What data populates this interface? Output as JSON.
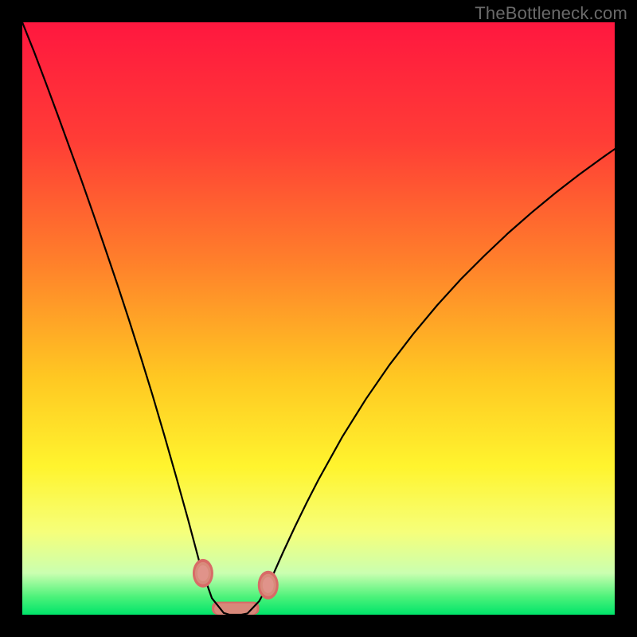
{
  "watermark": "TheBottleneck.com",
  "chart_data": {
    "type": "line",
    "title": "",
    "xlabel": "",
    "ylabel": "",
    "xlim": [
      0,
      100
    ],
    "ylim": [
      0,
      100
    ],
    "gradient_stops": [
      {
        "offset": 0,
        "color": "#ff173f"
      },
      {
        "offset": 20,
        "color": "#ff3d36"
      },
      {
        "offset": 40,
        "color": "#ff7e2b"
      },
      {
        "offset": 60,
        "color": "#ffc822"
      },
      {
        "offset": 75,
        "color": "#fff42e"
      },
      {
        "offset": 86,
        "color": "#f6ff7a"
      },
      {
        "offset": 93,
        "color": "#caffb0"
      },
      {
        "offset": 97,
        "color": "#4cf27a"
      },
      {
        "offset": 100,
        "color": "#00e46a"
      }
    ],
    "series": [
      {
        "name": "bottleneck-curve",
        "x": [
          0.0,
          2,
          4,
          6,
          8,
          10,
          12,
          14,
          16,
          18,
          20,
          22,
          24,
          26,
          28,
          30,
          32,
          34,
          35,
          36,
          37,
          38,
          40,
          42,
          44,
          46,
          48,
          50,
          54,
          58,
          62,
          66,
          70,
          74,
          78,
          82,
          86,
          90,
          94,
          98,
          100
        ],
        "values": [
          100,
          95,
          89.7,
          84.3,
          78.8,
          73.3,
          67.6,
          61.8,
          55.9,
          49.8,
          43.5,
          37,
          30.2,
          23.2,
          16,
          8.5,
          2.8,
          0.3,
          0,
          0,
          0,
          0.2,
          2.3,
          6,
          10.5,
          14.8,
          18.9,
          22.8,
          30,
          36.4,
          42.2,
          47.4,
          52.2,
          56.6,
          60.6,
          64.4,
          67.9,
          71.2,
          74.3,
          77.2,
          78.6
        ]
      }
    ],
    "markers": [
      {
        "name": "left-fat-dot",
        "x": 30.5,
        "y": 7.0,
        "colors": [
          "#d86b67",
          "#d88b7b",
          "#e0938a"
        ]
      },
      {
        "name": "right-fat-dot",
        "x": 41.5,
        "y": 5.0,
        "colors": [
          "#d86b67",
          "#d88b7b",
          "#e0938a"
        ]
      }
    ],
    "valley_band": {
      "x0": 32,
      "x1": 40,
      "y": 0,
      "h": 2.2,
      "colors": [
        "#d86b67",
        "#d8887a"
      ]
    }
  }
}
